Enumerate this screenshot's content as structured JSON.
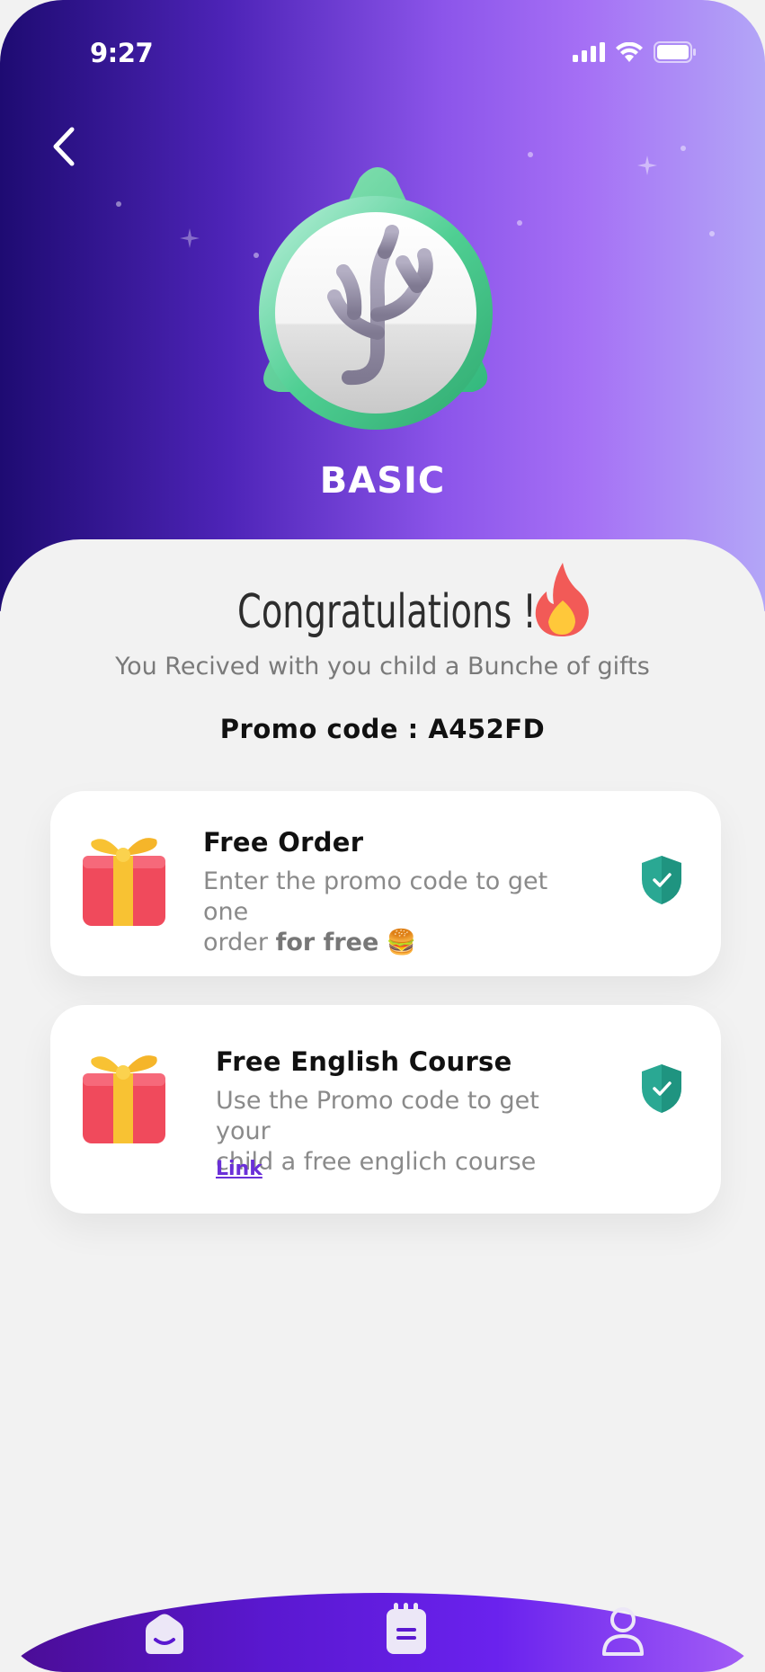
{
  "status_bar": {
    "time": "9:27"
  },
  "header": {
    "level_name": "BASIC"
  },
  "main": {
    "title": "Congratulations !",
    "subtitle": "You Recived with you child  a Bunche of gifts",
    "promo_label": "Promo code : A452FD"
  },
  "cards": [
    {
      "title": "Free Order",
      "desc_part1": "Enter the promo code to get  one",
      "desc_part2": "order",
      "desc_bold": "for free",
      "desc_emoji": "🍔"
    },
    {
      "title": "Free English Course",
      "desc_line1": "Use the Promo code to get your",
      "desc_line2": "child a free englich course",
      "link_label": "Link"
    }
  ],
  "colors": {
    "accent": "#6a2fd8",
    "badge_green": "#3dc48a",
    "shield_teal": "#2aa893",
    "gift_red": "#f04a5c",
    "ribbon_yellow": "#f8c233"
  },
  "icons": {
    "back": "chevron-left-icon",
    "badge": "coral-badge-icon",
    "fire": "fire-emoji-icon",
    "gift": "gift-box-icon",
    "shield": "shield-check-icon",
    "nav": [
      "home-icon",
      "notes-icon",
      "profile-icon"
    ]
  }
}
